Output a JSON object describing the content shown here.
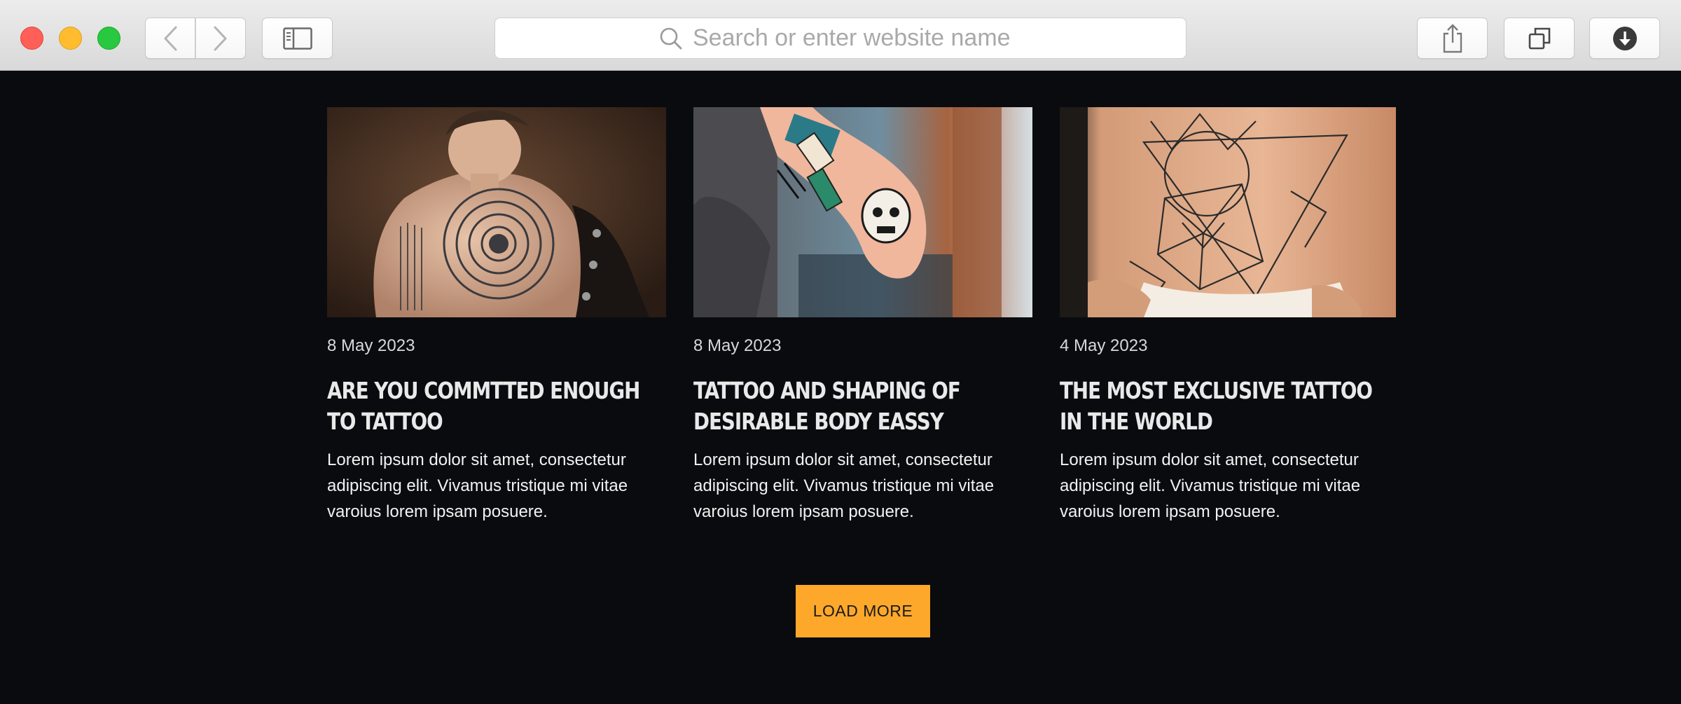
{
  "browser": {
    "address_placeholder": "Search or enter website name",
    "icons": {
      "back": "chevron-left-icon",
      "forward": "chevron-right-icon",
      "sidebar": "sidebar-icon",
      "search": "search-icon",
      "share": "share-icon",
      "tabs": "tabs-icon",
      "download": "download-icon"
    }
  },
  "posts": [
    {
      "date": "8 May 2023",
      "title": "ARE YOU COMMTTED ENOUGH TO TATTOO",
      "excerpt": "Lorem ipsum dolor sit amet, consectetur adipiscing elit. Vivamus tristique mi vitae varoius lorem ipsam posuere."
    },
    {
      "date": "8 May 2023",
      "title": "TATTOO AND SHAPING OF DESIRABLE BODY EASSY",
      "excerpt": "Lorem ipsum dolor sit amet, consectetur adipiscing elit. Vivamus tristique mi vitae varoius lorem ipsam posuere."
    },
    {
      "date": "4 May 2023",
      "title": "THE MOST EXCLUSIVE TATTOO IN THE WORLD",
      "excerpt": "Lorem ipsum dolor sit amet, consectetur adipiscing elit. Vivamus tristique mi vitae varoius lorem ipsam posuere."
    }
  ],
  "load_more_label": "LOAD MORE",
  "colors": {
    "page_background": "#0a0b0f",
    "accent": "#fda82b",
    "text": "#f2f2f2"
  }
}
